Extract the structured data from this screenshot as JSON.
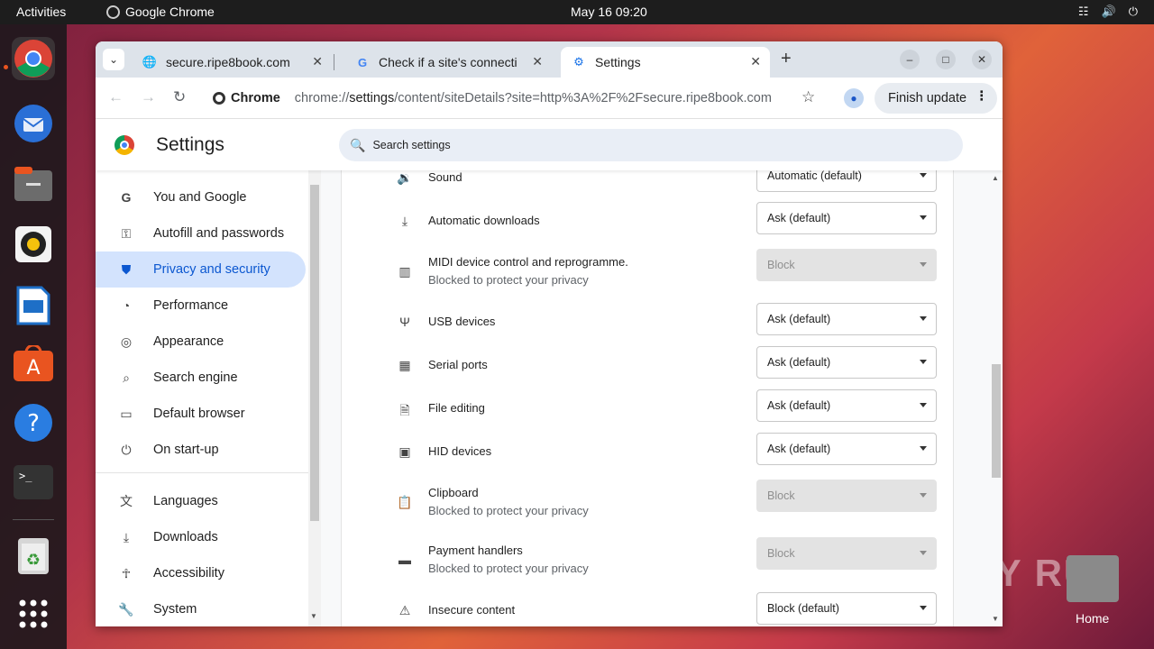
{
  "desktop": {
    "activities": "Activities",
    "app_name": "Google Chrome",
    "clock": "May 16  09:20",
    "home_label": "Home",
    "watermark": "ANY RUN"
  },
  "dock": {
    "items": [
      "chrome-icon",
      "thunderbird-icon",
      "files-icon",
      "rhythmbox-icon",
      "writer-icon",
      "app-center-icon",
      "help-icon",
      "terminal-icon",
      "trash-icon",
      "app-grid-icon"
    ]
  },
  "tabs": [
    {
      "title": "secure.ripe8book.com",
      "favicon": "globe-icon"
    },
    {
      "title": "Check if a site's connecti",
      "favicon": "google-icon"
    },
    {
      "title": "Settings",
      "favicon": "gear-icon",
      "active": true
    }
  ],
  "toolbar": {
    "chip_label": "Chrome",
    "url_prefix": "chrome://",
    "url_host": "settings",
    "url_path": "/content/siteDetails?site=http%3A%2F%2Fsecure.ripe8book.com",
    "finish_update": "Finish update"
  },
  "settings": {
    "title": "Settings",
    "search_placeholder": "Search settings"
  },
  "sidebar": {
    "items": [
      {
        "label": "You and Google",
        "icon": "google-g-icon"
      },
      {
        "label": "Autofill and passwords",
        "icon": "key-icon"
      },
      {
        "label": "Privacy and security",
        "icon": "shield-icon",
        "active": true
      },
      {
        "label": "Performance",
        "icon": "gauge-icon"
      },
      {
        "label": "Appearance",
        "icon": "palette-icon"
      },
      {
        "label": "Search engine",
        "icon": "search-icon"
      },
      {
        "label": "Default browser",
        "icon": "browser-icon"
      },
      {
        "label": "On start-up",
        "icon": "power-icon"
      },
      {
        "label": "Languages",
        "icon": "translate-icon"
      },
      {
        "label": "Downloads",
        "icon": "download-icon"
      },
      {
        "label": "Accessibility",
        "icon": "accessibility-icon"
      },
      {
        "label": "System",
        "icon": "wrench-icon"
      }
    ]
  },
  "permissions": [
    {
      "label": "Sound",
      "value": "Automatic (default)",
      "icon": "speaker-icon"
    },
    {
      "label": "Automatic downloads",
      "value": "Ask (default)",
      "icon": "download-icon"
    },
    {
      "label": "MIDI device control and reprogramme.",
      "sub": "Blocked to protect your privacy",
      "value": "Block",
      "icon": "piano-icon",
      "disabled": true
    },
    {
      "label": "USB devices",
      "value": "Ask (default)",
      "icon": "usb-icon"
    },
    {
      "label": "Serial ports",
      "value": "Ask (default)",
      "icon": "serial-icon"
    },
    {
      "label": "File editing",
      "value": "Ask (default)",
      "icon": "file-edit-icon"
    },
    {
      "label": "HID devices",
      "value": "Ask (default)",
      "icon": "gamepad-icon"
    },
    {
      "label": "Clipboard",
      "sub": "Blocked to protect your privacy",
      "value": "Block",
      "icon": "clipboard-icon",
      "disabled": true
    },
    {
      "label": "Payment handlers",
      "sub": "Blocked to protect your privacy",
      "value": "Block",
      "icon": "credit-card-icon",
      "disabled": true
    },
    {
      "label": "Insecure content",
      "value": "Block (default)",
      "icon": "warning-icon"
    }
  ]
}
